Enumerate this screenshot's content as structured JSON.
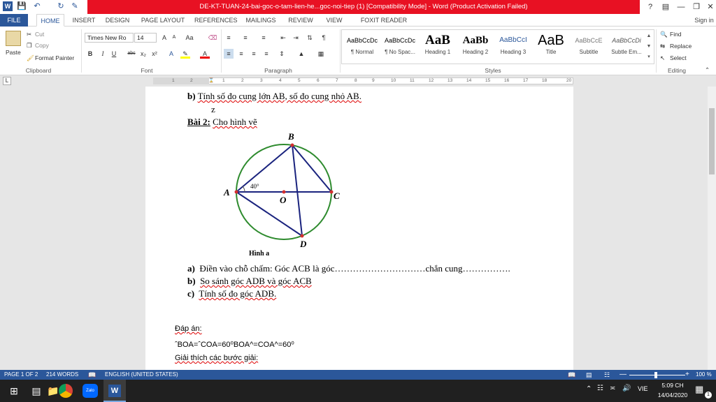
{
  "window": {
    "title": "DE-KT-TUAN-24-bai-goc-o-tam-lien-he...goc-noi-tiep (1) [Compatibility Mode] - Word (Product Activation Failed)",
    "sign_in": "Sign in",
    "help": "?"
  },
  "tabs": [
    "FILE",
    "HOME",
    "INSERT",
    "DESIGN",
    "PAGE LAYOUT",
    "REFERENCES",
    "MAILINGS",
    "REVIEW",
    "VIEW",
    "FOXIT READER PDF"
  ],
  "clipboard": {
    "paste": "Paste",
    "cut": "Cut",
    "copy": "Copy",
    "format_painter": "Format Painter",
    "label": "Clipboard"
  },
  "font": {
    "name": "Times New Ro",
    "size": "14",
    "label": "Font",
    "size_up": "A",
    "size_down": "A",
    "case": "Aa",
    "bold": "B",
    "italic": "I",
    "underline": "U",
    "strike": "abc",
    "sub": "x₂",
    "sup": "x²"
  },
  "paragraph": {
    "label": "Paragraph"
  },
  "styles": {
    "label": "Styles",
    "items": [
      {
        "preview": "AaBbCcDc",
        "name": "¶ Normal"
      },
      {
        "preview": "AaBbCcDc",
        "name": "¶ No Spac..."
      },
      {
        "preview": "AaB",
        "name": "Heading 1"
      },
      {
        "preview": "AaBb",
        "name": "Heading 2"
      },
      {
        "preview": "AaBbCcI",
        "name": "Heading 3"
      },
      {
        "preview": "AaB",
        "name": "Title"
      },
      {
        "preview": "AaBbCcE",
        "name": "Subtitle"
      },
      {
        "preview": "AaBbCcDi",
        "name": "Subtle Em..."
      }
    ]
  },
  "editing": {
    "find": "Find",
    "replace": "Replace",
    "select": "Select",
    "label": "Editing"
  },
  "ruler": [
    "1",
    "2",
    "1",
    "2",
    "3",
    "4",
    "5",
    "6",
    "7",
    "8",
    "9",
    "10",
    "11",
    "12",
    "13",
    "14",
    "15",
    "16",
    "17",
    "18",
    "20"
  ],
  "document": {
    "line_b": {
      "label": "b)",
      "text": "Tính số đo cung lớn AB, số đo cung nhỏ AB."
    },
    "stray": "z",
    "bai2": {
      "label": "Bài 2:",
      "text": "Cho hình vẽ"
    },
    "figure": {
      "B": "B",
      "A": "A",
      "O": "O",
      "C": "C",
      "D": "D",
      "angle": "40°",
      "caption": "Hình a"
    },
    "items": [
      {
        "label": "a)",
        "text": "Điền vào chỗ chấm: Góc ACB là góc…………………………chắn cung……………."
      },
      {
        "label": "b)",
        "text": "So sánh góc ADB và góc ACB"
      },
      {
        "label": "c)",
        "text": "Tính số đo góc ADB."
      }
    ],
    "answer_label": "Đáp án:",
    "answer_eq": "ˆBOA=ˆCOA=60⁰BOA^=COA^=60⁰",
    "explain": "Giải thích các bước giải:"
  },
  "status": {
    "page": "PAGE 1 OF 2",
    "words": "214 WORDS",
    "lang": "ENGLISH (UNITED STATES)",
    "zoom": "100 %"
  },
  "taskbar": {
    "lang": "VIE",
    "time": "5:09 CH",
    "date": "14/04/2020",
    "zalo": "Zalo",
    "notif": "1"
  }
}
